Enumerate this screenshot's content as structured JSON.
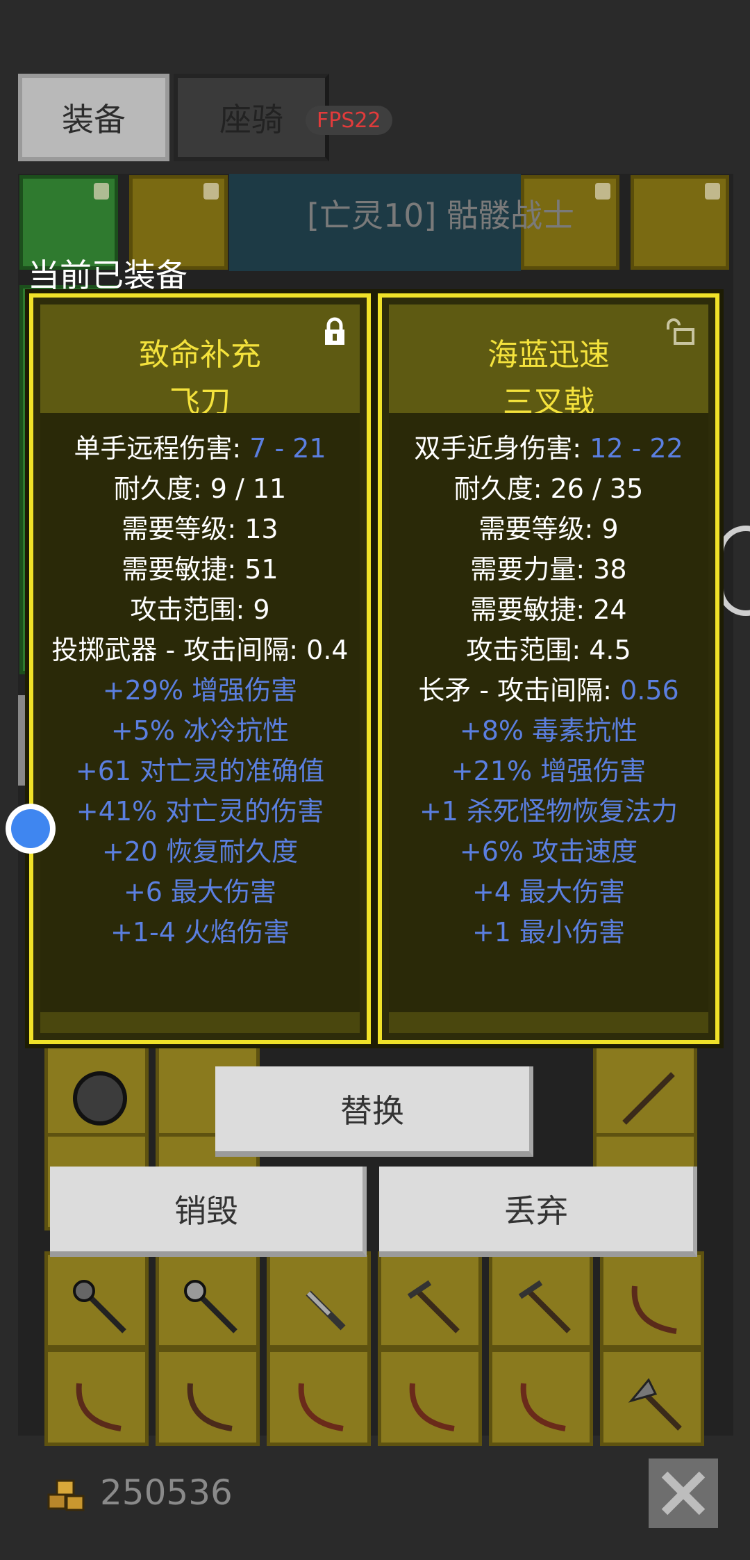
{
  "tabs": {
    "equip_label": "装备",
    "mount_label": "座骑",
    "fps": "FPS22"
  },
  "scene": {
    "monster_name": "[亡灵10] 骷髅战士"
  },
  "equipped_label": "当前已装备",
  "cards": [
    {
      "title": "致命补充",
      "subtitle": "飞刀",
      "lock_state": "locked",
      "stats": [
        {
          "label": "单手远程伤害: ",
          "value": "7 - 21"
        },
        {
          "label": "耐久度: 9 / 11",
          "value": ""
        },
        {
          "label": "需要等级: 13",
          "value": ""
        },
        {
          "label": "需要敏捷: 51",
          "value": ""
        },
        {
          "label": "攻击范围: 9",
          "value": ""
        },
        {
          "label": "投掷武器 - 攻击间隔: 0.4",
          "value": ""
        }
      ],
      "affixes": [
        "+29% 增强伤害",
        "+5% 冰冷抗性",
        "+61 对亡灵的准确值",
        "+41% 对亡灵的伤害",
        "+20 恢复耐久度",
        "+6 最大伤害",
        "+1-4 火焰伤害"
      ]
    },
    {
      "title": "海蓝迅速",
      "subtitle": "三叉戟",
      "lock_state": "unlocked",
      "stats": [
        {
          "label": "双手近身伤害: ",
          "value": "12 - 22"
        },
        {
          "label": "耐久度: 26 / 35",
          "value": ""
        },
        {
          "label": "需要等级: 9",
          "value": ""
        },
        {
          "label": "需要力量: 38",
          "value": ""
        },
        {
          "label": "需要敏捷: 24",
          "value": ""
        },
        {
          "label": "攻击范围: 4.5",
          "value": ""
        },
        {
          "label": "长矛 - 攻击间隔: ",
          "value": "0.56"
        }
      ],
      "affixes": [
        "+8% 毒素抗性",
        "+21% 增强伤害",
        "+1 杀死怪物恢复法力",
        "+6% 攻击速度",
        "+4 最大伤害",
        "+1 最小伤害"
      ]
    }
  ],
  "buttons": {
    "replace": "替换",
    "destroy": "销毁",
    "discard": "丢弃"
  },
  "footer": {
    "gold": "250536"
  },
  "colors": {
    "card_border": "#f0e229",
    "title_text": "#f4e23c",
    "affix_blue": "#5b7fe0",
    "fps_red": "#e23b3b"
  }
}
